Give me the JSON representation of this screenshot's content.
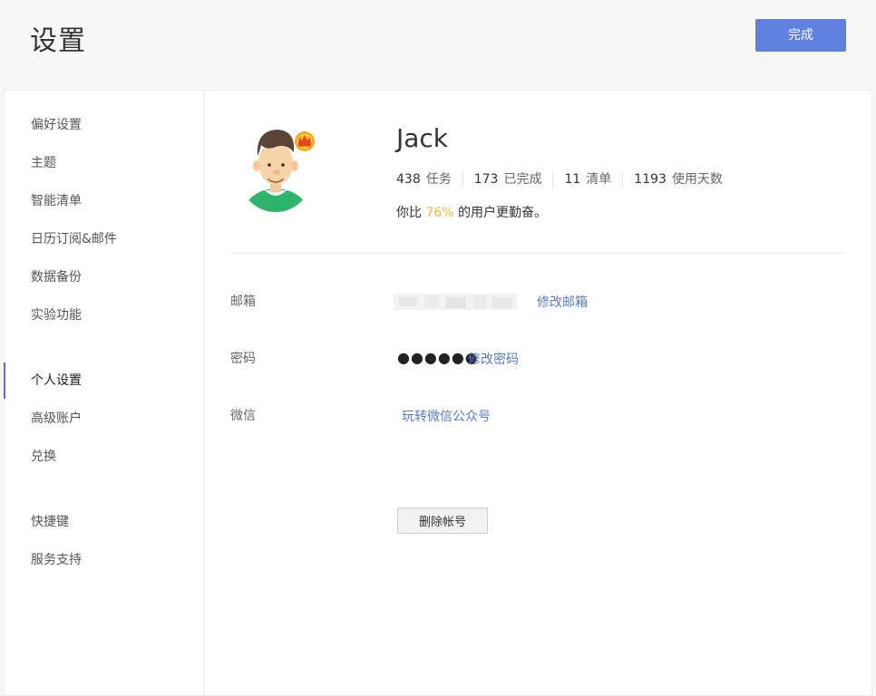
{
  "header": {
    "title": "设置",
    "done_label": "完成"
  },
  "sidebar": {
    "items": [
      {
        "label": "偏好设置"
      },
      {
        "label": "主题"
      },
      {
        "label": "智能清单"
      },
      {
        "label": "日历订阅&邮件"
      },
      {
        "label": "数据备份"
      },
      {
        "label": "实验功能"
      },
      {
        "label": "个人设置",
        "active": true
      },
      {
        "label": "高级账户"
      },
      {
        "label": "兑换"
      },
      {
        "label": "快捷键"
      },
      {
        "label": "服务支持"
      }
    ]
  },
  "profile": {
    "username": "Jack",
    "avatar_icon": "cartoon-user-avatar",
    "badge_icon": "crown-icon",
    "stats": [
      {
        "value": "438",
        "label": "任务"
      },
      {
        "value": "173",
        "label": "已完成"
      },
      {
        "value": "11",
        "label": "清单"
      },
      {
        "value": "1193",
        "label": "使用天数"
      }
    ],
    "compare_prefix": "你比",
    "compare_pct": "76%",
    "compare_suffix": "的用户更勤奋。"
  },
  "account": {
    "email_label": "邮箱",
    "email_change": "修改邮箱",
    "password_label": "密码",
    "password_dots": "●●●●●●",
    "password_change": "修改密码",
    "wechat_label": "微信",
    "wechat_link": "玩转微信公众号",
    "delete_label": "删除帐号"
  },
  "colors": {
    "primary": "#6181e0",
    "link": "#5879c9",
    "accent": "#f0b43c",
    "active_bar": "#5b6fc9"
  }
}
